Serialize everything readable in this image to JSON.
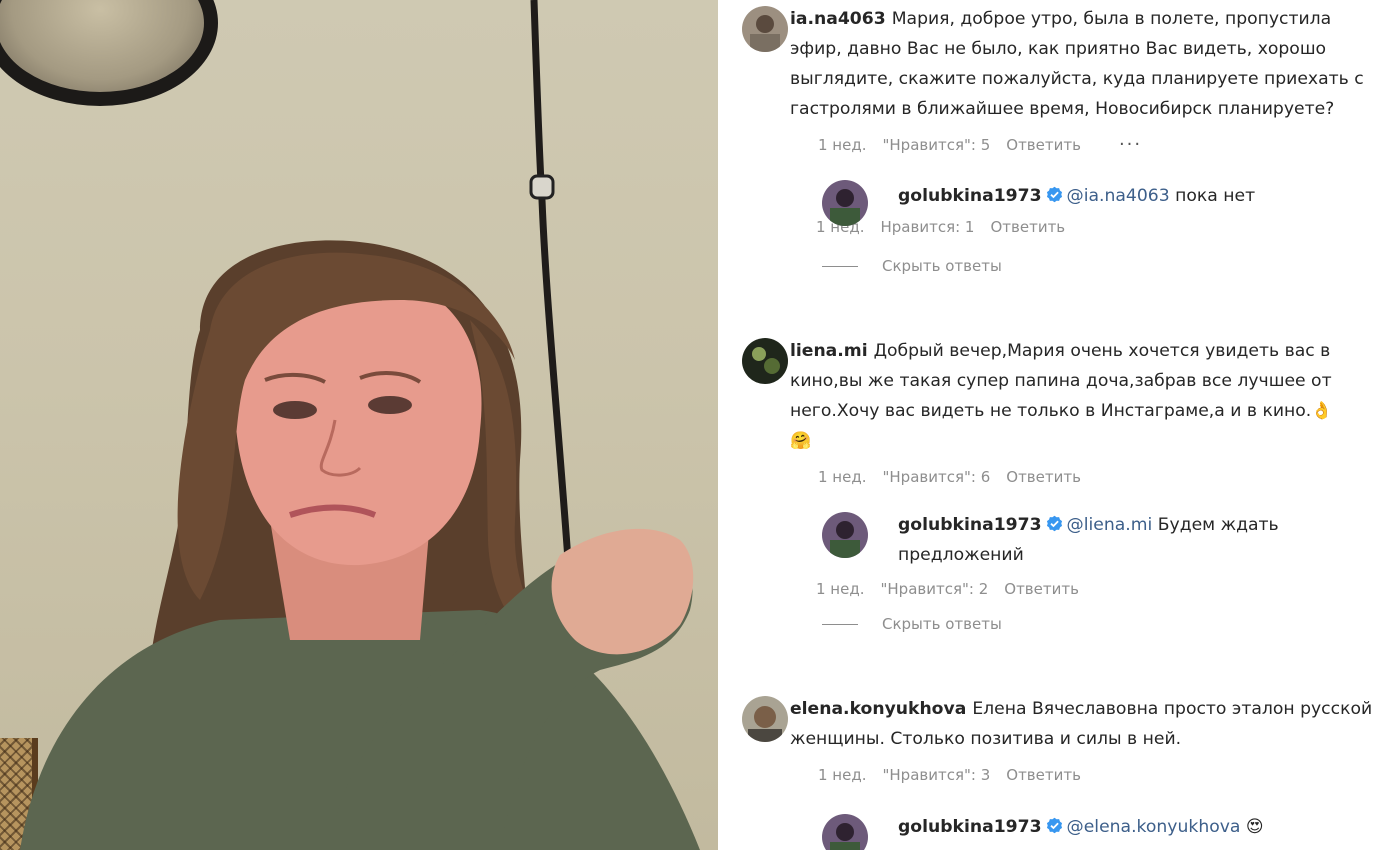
{
  "comments": [
    {
      "username": "ia.na4063",
      "text": "Мария, доброе утро, была в полете, пропустила эфир, давно Вас не было, как приятно Вас видеть, хорошо выглядите, скажите пожалуйста, куда планируете приехать с гастролями в ближайшее время, Новосибирск планируете?",
      "time": "1 нед.",
      "likes": "\"Нравится\": 5",
      "reply_label": "Ответить",
      "more_icon": "more-dots-icon",
      "more_glyph": "···",
      "reply": {
        "username": "golubkina1973",
        "verified": true,
        "mention": "@ia.na4063",
        "text": "пока нет",
        "time": "1 нед.",
        "likes": "Нравится: 1",
        "reply_label": "Ответить"
      },
      "hide_replies_label": "Скрыть ответы"
    },
    {
      "username": "liena.mi",
      "text": "Добрый вечер,Мария очень хочется увидеть вас в кино,вы же такая супер папина доча,забрав все лучшее от него.Хочу вас видеть не только в Инстаграме,а и в кино.",
      "emoji_1": "👌",
      "emoji_2": "🤗",
      "time": "1 нед.",
      "likes": "\"Нравится\": 6",
      "reply_label": "Ответить",
      "reply": {
        "username": "golubkina1973",
        "verified": true,
        "mention": "@liena.mi",
        "text": "Будем ждать предложений",
        "time": "1 нед.",
        "likes": "\"Нравится\": 2",
        "reply_label": "Ответить"
      },
      "hide_replies_label": "Скрыть ответы"
    },
    {
      "username": "elena.konyukhova",
      "text": "Елена Вячеславовна просто эталон русской женщины. Столько позитива и силы в ней.",
      "time": "1 нед.",
      "likes": "\"Нравится\": 3",
      "reply_label": "Ответить",
      "reply": {
        "username": "golubkina1973",
        "verified": true,
        "mention": "@elena.konyukhova",
        "emoji": "😍"
      }
    }
  ],
  "colors": {
    "text": "#262626",
    "meta": "#8e8e8e",
    "mention": "#3d5f8a",
    "verified": "#3897f0"
  }
}
